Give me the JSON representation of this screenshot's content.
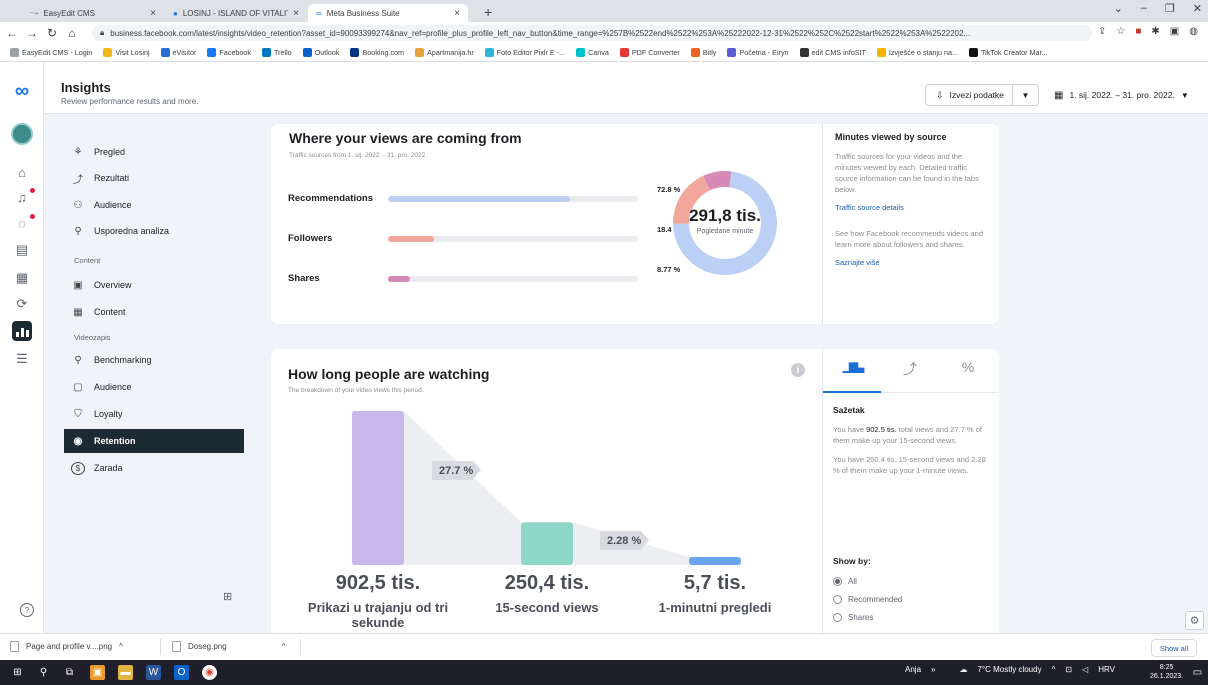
{
  "browser": {
    "tabs": [
      {
        "title": "EasyEdit CMS",
        "active": false
      },
      {
        "title": "LOSINJ - ISLAND OF VITALITY | Fa",
        "active": false
      },
      {
        "title": "Meta Business Suite",
        "active": true
      }
    ],
    "new_tab": "+",
    "url": "business.facebook.com/latest/insights/video_retention?asset_id=90093399274&nav_ref=profile_plus_profile_left_nav_button&time_range=%257B%2522end%2522%253A%25222022-12-31%2522%252C%2522start%2522%253A%2522202...",
    "bookmarks": [
      {
        "label": "EasyEdit CMS - Login",
        "color": "#9aa0a6"
      },
      {
        "label": "Visit Losinj",
        "color": "#f2b81b"
      },
      {
        "label": "eVisitor",
        "color": "#2a6cd6"
      },
      {
        "label": "Facebook",
        "color": "#1877f2"
      },
      {
        "label": "Trello",
        "color": "#0079bf"
      },
      {
        "label": "Outlook",
        "color": "#0a64c8"
      },
      {
        "label": "Booking.com",
        "color": "#003580"
      },
      {
        "label": "Apartmanija.hr",
        "color": "#e8a33d"
      },
      {
        "label": "Foto Editor Pixlr E -...",
        "color": "#2fb7d8"
      },
      {
        "label": "Canva",
        "color": "#00c4cc"
      },
      {
        "label": "PDF Converter",
        "color": "#e53935"
      },
      {
        "label": "Bitly",
        "color": "#ee6123"
      },
      {
        "label": "Početna - Eiryn",
        "color": "#5a5fd6"
      },
      {
        "label": "edit CMS infoSIT",
        "color": "#333333"
      },
      {
        "label": "Izvješće o stanju na...",
        "color": "#f7b500"
      },
      {
        "label": "TikTok Creator Mar...",
        "color": "#111111"
      }
    ]
  },
  "header": {
    "title": "Insights",
    "subtitle": "Review performance results and more.",
    "export_label": "Izvezi podatke",
    "date_range": "1. sij. 2022. – 31. pro. 2022."
  },
  "sidenav": {
    "items": [
      {
        "label": "Pregled",
        "icon": "hub-icon"
      },
      {
        "label": "Rezultati",
        "icon": "trend-icon"
      },
      {
        "label": "Audience",
        "icon": "people-icon"
      },
      {
        "label": "Usporedna analiza",
        "icon": "compare-icon"
      }
    ],
    "content_heading": "Content",
    "content_items": [
      {
        "label": "Overview",
        "icon": "overview-icon"
      },
      {
        "label": "Content",
        "icon": "table-icon"
      }
    ],
    "video_heading": "Videozapis",
    "video_items": [
      {
        "label": "Benchmarking",
        "icon": "compare-icon"
      },
      {
        "label": "Audience",
        "icon": "video-audience-icon"
      },
      {
        "label": "Loyalty",
        "icon": "shield-icon"
      },
      {
        "label": "Retention",
        "icon": "retention-icon",
        "active": true
      },
      {
        "label": "Zarada",
        "icon": "dollar-icon"
      }
    ]
  },
  "traffic": {
    "title": "Where your views are coming from",
    "subtitle": "Traffic sources from 1. sij. 2022. - 31. pro. 2022.",
    "total_value": "291,8 tis.",
    "total_label": "Pogledane minute",
    "side_title": "Minutes viewed by source",
    "side_desc": "Traffic sources for your videos and the minutes viewed by each. Detailed traffic source information can be found in the tabs below.",
    "side_link": "Traffic source details",
    "side_desc2": "See how Facebook recommends videos and learn more about followers and shares.",
    "side_link2": "Saznajte više"
  },
  "watching": {
    "title": "How long people are watching",
    "subtitle": "The breakdown of your video views this period.",
    "tabs": [
      "bar-chart-icon",
      "line-chart-icon",
      "percent-icon"
    ],
    "tab_glyphs": [
      "▁▆▃",
      "⤴",
      "%"
    ],
    "summary_title": "Sažetak",
    "summary_p1a": "You have ",
    "summary_p1b": "902.5 tis.",
    "summary_p1c": " total views and 27.7 % of them make up your 15-second views.",
    "summary_p2": "You have 250.4 tis. 15-second views and 2.28 % of them make up your 1-minute views.",
    "show_by_title": "Show by:",
    "show_by_options": [
      "All",
      "Recommended",
      "Shares"
    ],
    "show_by_selected": "All"
  },
  "downloads": {
    "items": [
      "Page and profile v....png",
      "Doseg.png"
    ],
    "show_all": "Show all"
  },
  "taskbar": {
    "user": "Anja",
    "weather": "7°C  Mostly cloudy",
    "lang": "HRV",
    "time": "8:25",
    "date": "26.1.2023."
  },
  "colors": {
    "recommendations": "#bcd0f5",
    "followers": "#f2a79c",
    "shares": "#d68ab8",
    "bar_3s": "#c8b8ea",
    "bar_15s": "#8fd7c6",
    "bar_1m": "#6aa6ef",
    "accent": "#1a6ed8",
    "nav_active": "#1c2b33"
  },
  "chart_data": [
    {
      "type": "bar",
      "title": "Where your views are coming from",
      "categories": [
        "Recommendations",
        "Followers",
        "Shares"
      ],
      "values": [
        72.8,
        18.4,
        8.77
      ],
      "value_labels": [
        "72.8 %",
        "18.4 %",
        "8.77 %"
      ],
      "unit": "%",
      "orientation": "horizontal",
      "xlim": [
        0,
        100
      ]
    },
    {
      "type": "pie",
      "subtype": "donut",
      "categories": [
        "Recommendations",
        "Followers",
        "Shares"
      ],
      "values": [
        72.8,
        18.4,
        8.77
      ],
      "center_value": "291,8 tis.",
      "center_label": "Pogledane minute"
    },
    {
      "type": "bar",
      "title": "How long people are watching",
      "categories": [
        "Prikazi u trajanju od tri sekunde",
        "15-second views",
        "1-minutni pregledi"
      ],
      "values": [
        902.5,
        250.4,
        5.7
      ],
      "value_labels": [
        "902,5 tis.",
        "250,4 tis.",
        "5,7 tis."
      ],
      "unit": "tis.",
      "conversion_labels": [
        "27.7 %",
        "2.28 %"
      ]
    }
  ]
}
